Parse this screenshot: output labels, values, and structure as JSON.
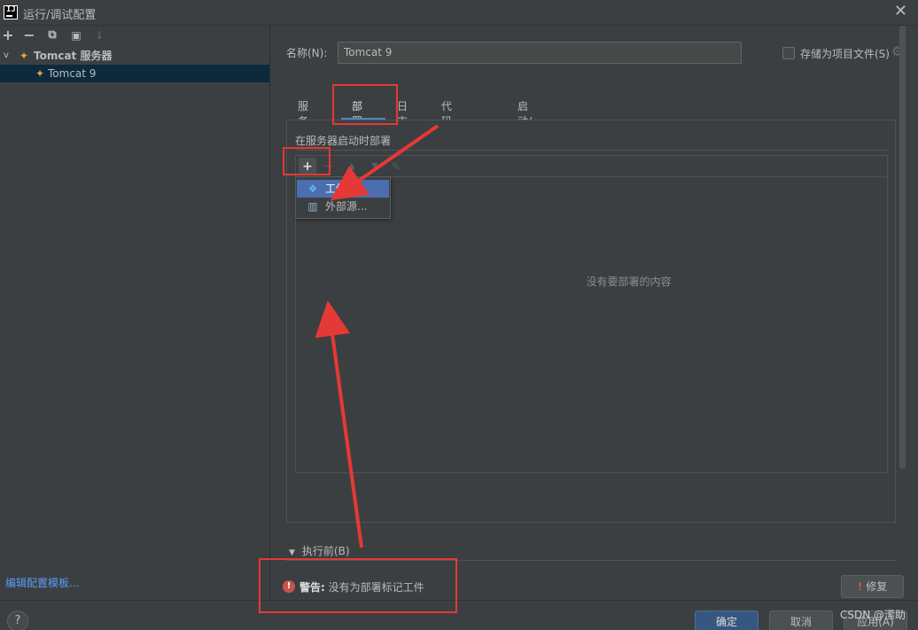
{
  "window": {
    "logo": "IJ",
    "title": "运行/调试配置",
    "close_glyph": "✕"
  },
  "left_toolbar": {
    "add": "+",
    "remove": "−",
    "copy": "⧉",
    "folder": "▣",
    "sort": "↓"
  },
  "tree": {
    "group_chevron": "v",
    "group_label": "Tomcat 服务器",
    "item_label": "Tomcat 9"
  },
  "edit_templates_link": "编辑配置模板...",
  "form": {
    "name_label": "名称(N):",
    "name_value": "Tomcat 9",
    "store_label": "存储为项目文件(S)"
  },
  "tabs": [
    {
      "label": "服务器"
    },
    {
      "label": "部署"
    },
    {
      "label": "日志"
    },
    {
      "label": "代码覆盖率"
    },
    {
      "label": "启动/连接"
    }
  ],
  "deploy": {
    "section_title": "在服务器启动时部署",
    "add_glyph": "+",
    "empty_text": "没有要部署的内容"
  },
  "popup_menu": {
    "items": [
      {
        "label": "工件...",
        "icon": "artifact-icon"
      },
      {
        "label": "外部源...",
        "icon": "external-source-icon"
      }
    ]
  },
  "before_launch": {
    "label": "执行前(B)"
  },
  "warning": {
    "prefix": "警告:",
    "message": "没有为部署标记工件"
  },
  "buttons": {
    "fix": "修复",
    "ok": "确定",
    "cancel": "取消",
    "apply": "应用(A)",
    "help": "?"
  },
  "watermark": "CSDN @潆助",
  "colors": {
    "accent": "#4a88c7",
    "annotation": "#e53935",
    "selection": "#4b6eaf"
  }
}
